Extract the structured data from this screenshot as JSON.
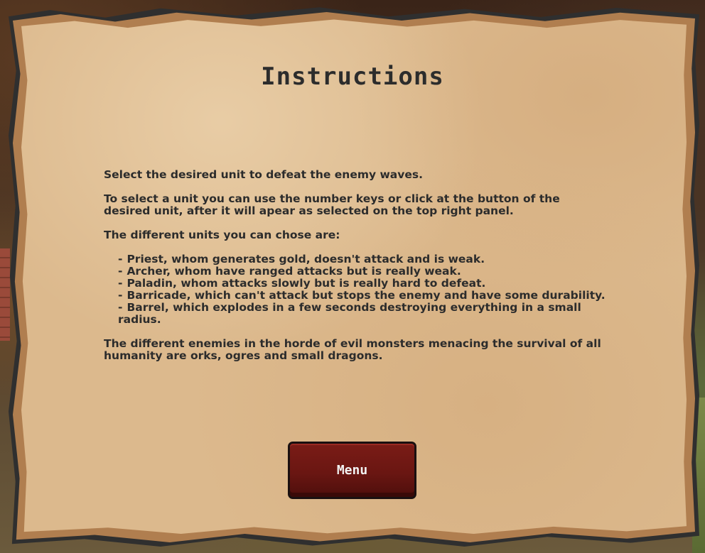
{
  "screen": {
    "title": "Instructions"
  },
  "instructions": {
    "intro": "Select the desired unit to defeat the enemy waves.",
    "select_help": "To select a unit you can use the number keys or click at the button of the desired unit, after it will apear as selected on the top right panel.",
    "units_heading": "The different units you can chose are:",
    "units": [
      "Priest, whom generates gold, doesn't attack and is weak.",
      "Archer, whom have ranged attacks but is really weak.",
      "Paladin, whom attacks slowly but is really hard to defeat.",
      "Barricade, which can't attack but stops the enemy and have some durability.",
      "Barrel, which explodes in a few seconds destroying everything in a small radius."
    ],
    "enemies": "The different enemies in the horde of evil monsters menacing the survival of all humanity are orks, ogres and small dragons."
  },
  "buttons": {
    "menu_label": "Menu"
  },
  "colors": {
    "parchment": "#dcb98d",
    "text": "#2c2c2c",
    "button": "#6a1612"
  }
}
